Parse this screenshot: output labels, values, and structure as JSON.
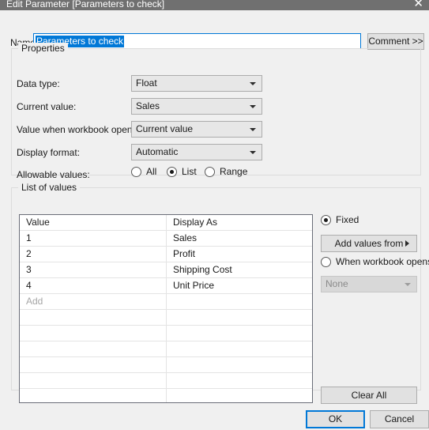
{
  "window": {
    "title": "Edit Parameter [Parameters to check]",
    "close_icon": "close-icon",
    "close_glyph": "✕"
  },
  "name_row": {
    "label": "Name:",
    "value": "Parameters to check",
    "comment_button": "Comment >>"
  },
  "properties": {
    "legend": "Properties",
    "rows": [
      {
        "label": "Data type:",
        "value": "Float"
      },
      {
        "label": "Current value:",
        "value": "Sales"
      },
      {
        "label": "Value when workbook opens:",
        "value": "Current value"
      },
      {
        "label": "Display format:",
        "value": "Automatic"
      }
    ],
    "allowable": {
      "label": "Allowable values:",
      "options": [
        {
          "label": "All",
          "checked": false
        },
        {
          "label": "List",
          "checked": true
        },
        {
          "label": "Range",
          "checked": false
        }
      ]
    }
  },
  "list_of_values": {
    "legend": "List of values",
    "columns": [
      "Value",
      "Display As"
    ],
    "rows": [
      {
        "value": "1",
        "display_as": "Sales"
      },
      {
        "value": "2",
        "display_as": "Profit"
      },
      {
        "value": "3",
        "display_as": "Shipping Cost"
      },
      {
        "value": "4",
        "display_as": "Unit Price"
      }
    ],
    "add_placeholder": "Add",
    "empty_row_count": 6
  },
  "source_options": {
    "fixed": {
      "label": "Fixed",
      "checked": true
    },
    "add_values_from": "Add values from",
    "when_workbook_opens": {
      "label": "When workbook opens",
      "checked": false
    },
    "workbook_source": "None",
    "clear_all": "Clear All"
  },
  "footer": {
    "ok": "OK",
    "cancel": "Cancel"
  },
  "colors": {
    "titlebar": "#707070",
    "dialog_bg": "#f0f0f0",
    "accent": "#0078d7",
    "selection": "#0078d7",
    "button_face": "#e1e1e1",
    "field_bg": "#ffffff",
    "disabled_text": "#8a8a8a"
  }
}
